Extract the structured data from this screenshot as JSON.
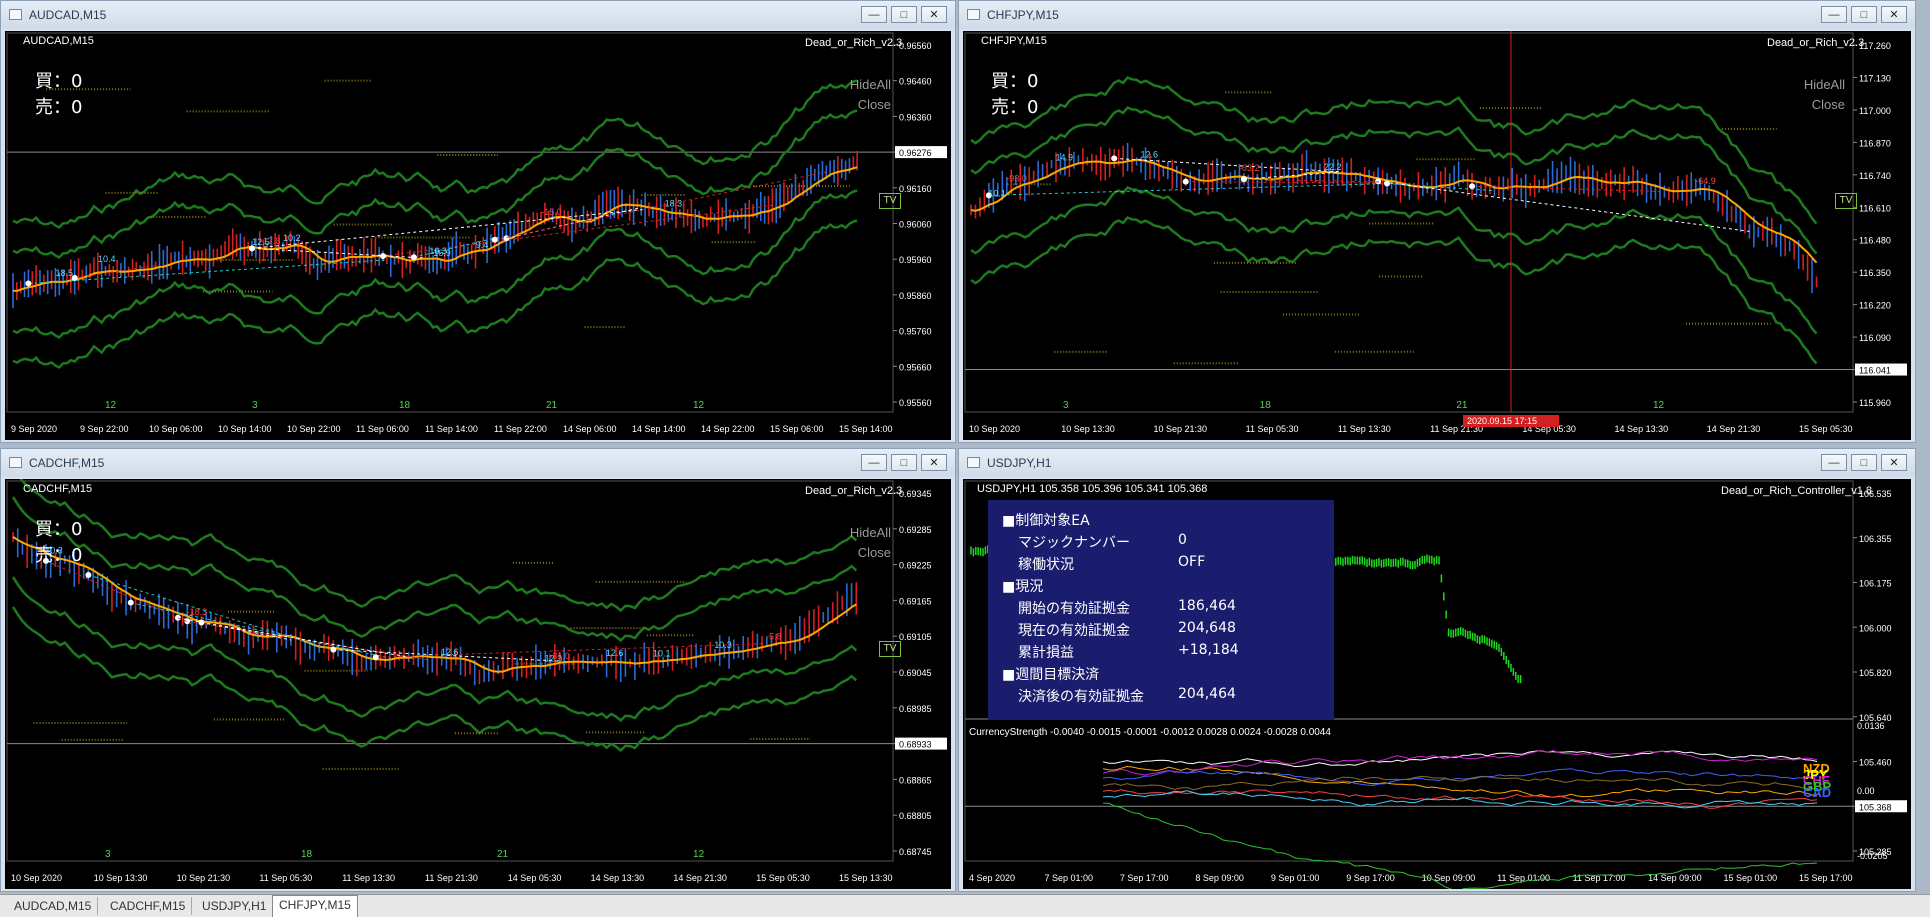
{
  "windows": [
    {
      "title": "AUDCAD,M15",
      "symbol": "AUDCAD,M15",
      "ea": "Dead_or_Rich_v2.3",
      "buy": "買：0",
      "sell": "売：0",
      "hideall": "HideAll",
      "close_btn": "Close",
      "tv": "TV",
      "prices": [
        "0.96560",
        "0.96460",
        "0.96360",
        "0.96276",
        "0.96160",
        "0.96060",
        "0.95960",
        "0.95860",
        "0.95760",
        "0.95660",
        "0.95560"
      ],
      "current_price": "0.96276",
      "dates": [
        "9 Sep 2020",
        "9 Sep 22:00",
        "10 Sep 06:00",
        "10 Sep 14:00",
        "10 Sep 22:00",
        "11 Sep 06:00",
        "11 Sep 14:00",
        "11 Sep 22:00",
        "14 Sep 06:00",
        "14 Sep 14:00",
        "14 Sep 22:00",
        "15 Sep 06:00",
        "15 Sep 14:00"
      ],
      "hours": [
        "12",
        "3",
        "18",
        "21",
        "12"
      ],
      "labels": [
        "10.4",
        "10.2",
        "-17.8",
        "-15.0",
        "9.4",
        "10.3",
        "12.5",
        "18.5",
        "18.3",
        "16.9"
      ]
    },
    {
      "title": "CHFJPY,M15",
      "symbol": "CHFJPY,M15",
      "ea": "Dead_or_Rich_v2.3",
      "buy": "買：0",
      "sell": "売：0",
      "hideall": "HideAll",
      "close_btn": "Close",
      "tv": "TV",
      "prices": [
        "117.260",
        "117.130",
        "117.000",
        "116.870",
        "116.740",
        "116.610",
        "116.480",
        "116.350",
        "116.220",
        "116.090",
        "116.041",
        "115.960"
      ],
      "current_price": "116.041",
      "dates": [
        "10 Sep 2020",
        "10 Sep 13:30",
        "10 Sep 21:30",
        "11 Sep 05:30",
        "11 Sep 13:30",
        "11 Sep 21:30",
        "14 Sep 05:30",
        "14 Sep 13:30",
        "14 Sep 21:30",
        "15 Sep 05:30"
      ],
      "time_cursor": "2020.09.15 17:15",
      "hours": [
        "3",
        "18",
        "21",
        "12"
      ],
      "labels": [
        "-93.0",
        "-64.9",
        "-63.2",
        "14.9",
        "22.2",
        "12.6",
        "10.1"
      ]
    },
    {
      "title": "CADCHF,M15",
      "symbol": "CADCHF,M15",
      "ea": "Dead_or_Rich_v2.3",
      "buy": "買：0",
      "sell": "売：0",
      "hideall": "HideAll",
      "close_btn": "Close",
      "tv": "TV",
      "prices": [
        "0.69345",
        "0.69285",
        "0.69225",
        "0.69165",
        "0.69105",
        "0.69045",
        "0.68985",
        "0.68933",
        "0.68865",
        "0.68805",
        "0.68745"
      ],
      "current_price": "0.68933",
      "dates": [
        "10 Sep 2020",
        "10 Sep 13:30",
        "10 Sep 21:30",
        "11 Sep 05:30",
        "11 Sep 13:30",
        "11 Sep 21:30",
        "14 Sep 05:30",
        "14 Sep 13:30",
        "14 Sep 21:30",
        "15 Sep 05:30",
        "15 Sep 13:30"
      ],
      "hours": [
        "3",
        "18",
        "21",
        "12"
      ],
      "labels": [
        "12.6",
        "10.3",
        "10.3",
        "-5.8",
        "10.1",
        "12.6",
        "12.3",
        "-31.0",
        "-18.3"
      ]
    },
    {
      "title": "USDJPY,H1",
      "symbol": "USDJPY,H1",
      "ohlc": "105.358 105.396 105.341 105.368",
      "ea": "Dead_or_Rich_Controller_v1.8",
      "prices": [
        "106.535",
        "106.355",
        "106.175",
        "106.000",
        "105.820",
        "105.640",
        "105.460",
        "105.368",
        "105.285"
      ],
      "current_price": "105.368",
      "indicator": "CurrencyStrength -0.0040 -0.0015 -0.0001 -0.0012 0.0028 0.0024 -0.0028 0.0044",
      "ind_scale": [
        "0.0136",
        "0.00",
        "-0.0205"
      ],
      "currencies": [
        "NZD",
        "JPY",
        "CHF",
        "GBP",
        "CAD"
      ],
      "dates": [
        "4 Sep 2020",
        "7 Sep 01:00",
        "7 Sep 17:00",
        "8 Sep 09:00",
        "9 Sep 01:00",
        "9 Sep 17:00",
        "10 Sep 09:00",
        "11 Sep 01:00",
        "11 Sep 17:00",
        "14 Sep 09:00",
        "15 Sep 01:00",
        "15 Sep 17:00"
      ]
    }
  ],
  "controller": {
    "h1": "■制御対象EA",
    "magic_label": "マジックナンバー",
    "magic_val": "0",
    "status_label": "稼働状況",
    "status_val": "OFF",
    "h2": "■現況",
    "start_label": "開始の有効証拠金",
    "start_val": "186,464",
    "now_label": "現在の有効証拠金",
    "now_val": "204,648",
    "pl_label": "累計損益",
    "pl_val": "+18,184",
    "h3": "■週間目標決済",
    "after_label": "決済後の有効証拠金",
    "after_val": "204,464"
  },
  "tabs": [
    "AUDCAD,M15",
    "CADCHF,M15",
    "USDJPY,H1",
    "CHFJPY,M15"
  ],
  "active_tab": "CHFJPY,M15",
  "colors": {
    "bull": "#2a6bd6",
    "bear": "#d42020",
    "ma": "#ffa500",
    "band": "#1e7a1e",
    "accent": "#1a1d6e"
  }
}
